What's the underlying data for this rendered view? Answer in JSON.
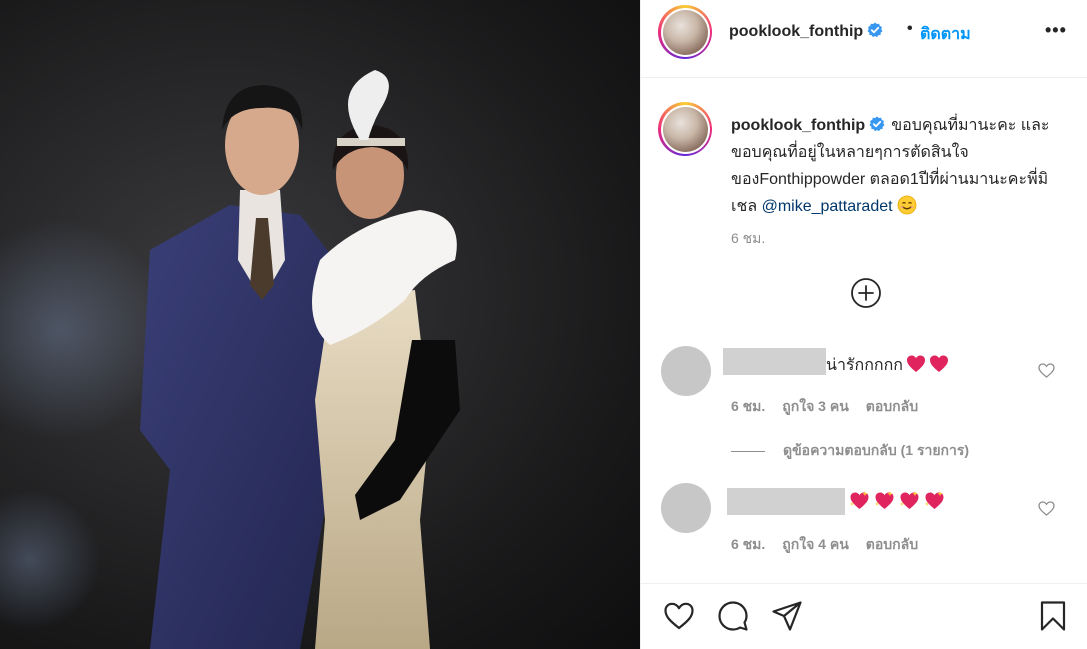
{
  "post": {
    "username": "pooklook_fonthip",
    "follow_label": "ติดตาม",
    "separator": "•",
    "more_label": "•••",
    "caption_text": "ขอบคุณที่มานะคะ และ ขอบคุณที่อยู่ในหลายๆการตัดสินใจของFonthippowder ตลอด1ปีที่ผ่านมานะคะพี่มิเชล ",
    "caption_mention": "@mike_pattaradet",
    "caption_time": "6 ชม."
  },
  "comments": [
    {
      "text": "น่ารักกกกก",
      "emoji_count": 2,
      "time": "6 ชม.",
      "likes": "ถูกใจ 3 คน",
      "reply_label": "ตอบกลับ",
      "view_replies": "ดูข้อความตอบกลับ (1 รายการ)"
    },
    {
      "text": "",
      "emoji_count": 4,
      "time": "6 ชม.",
      "likes": "ถูกใจ 4 คน",
      "reply_label": "ตอบกลับ"
    }
  ],
  "icons": {
    "verified": "verified-badge-icon",
    "load_more": "plus-circle-icon",
    "like": "heart-outline-icon",
    "comment": "comment-bubble-icon",
    "share": "paper-plane-icon",
    "save": "bookmark-icon"
  },
  "colors": {
    "link_blue": "#0095f6",
    "verified_blue": "#3897f0",
    "text": "#262626",
    "muted": "#8e8e8e",
    "heart_red": "#e0245e"
  }
}
